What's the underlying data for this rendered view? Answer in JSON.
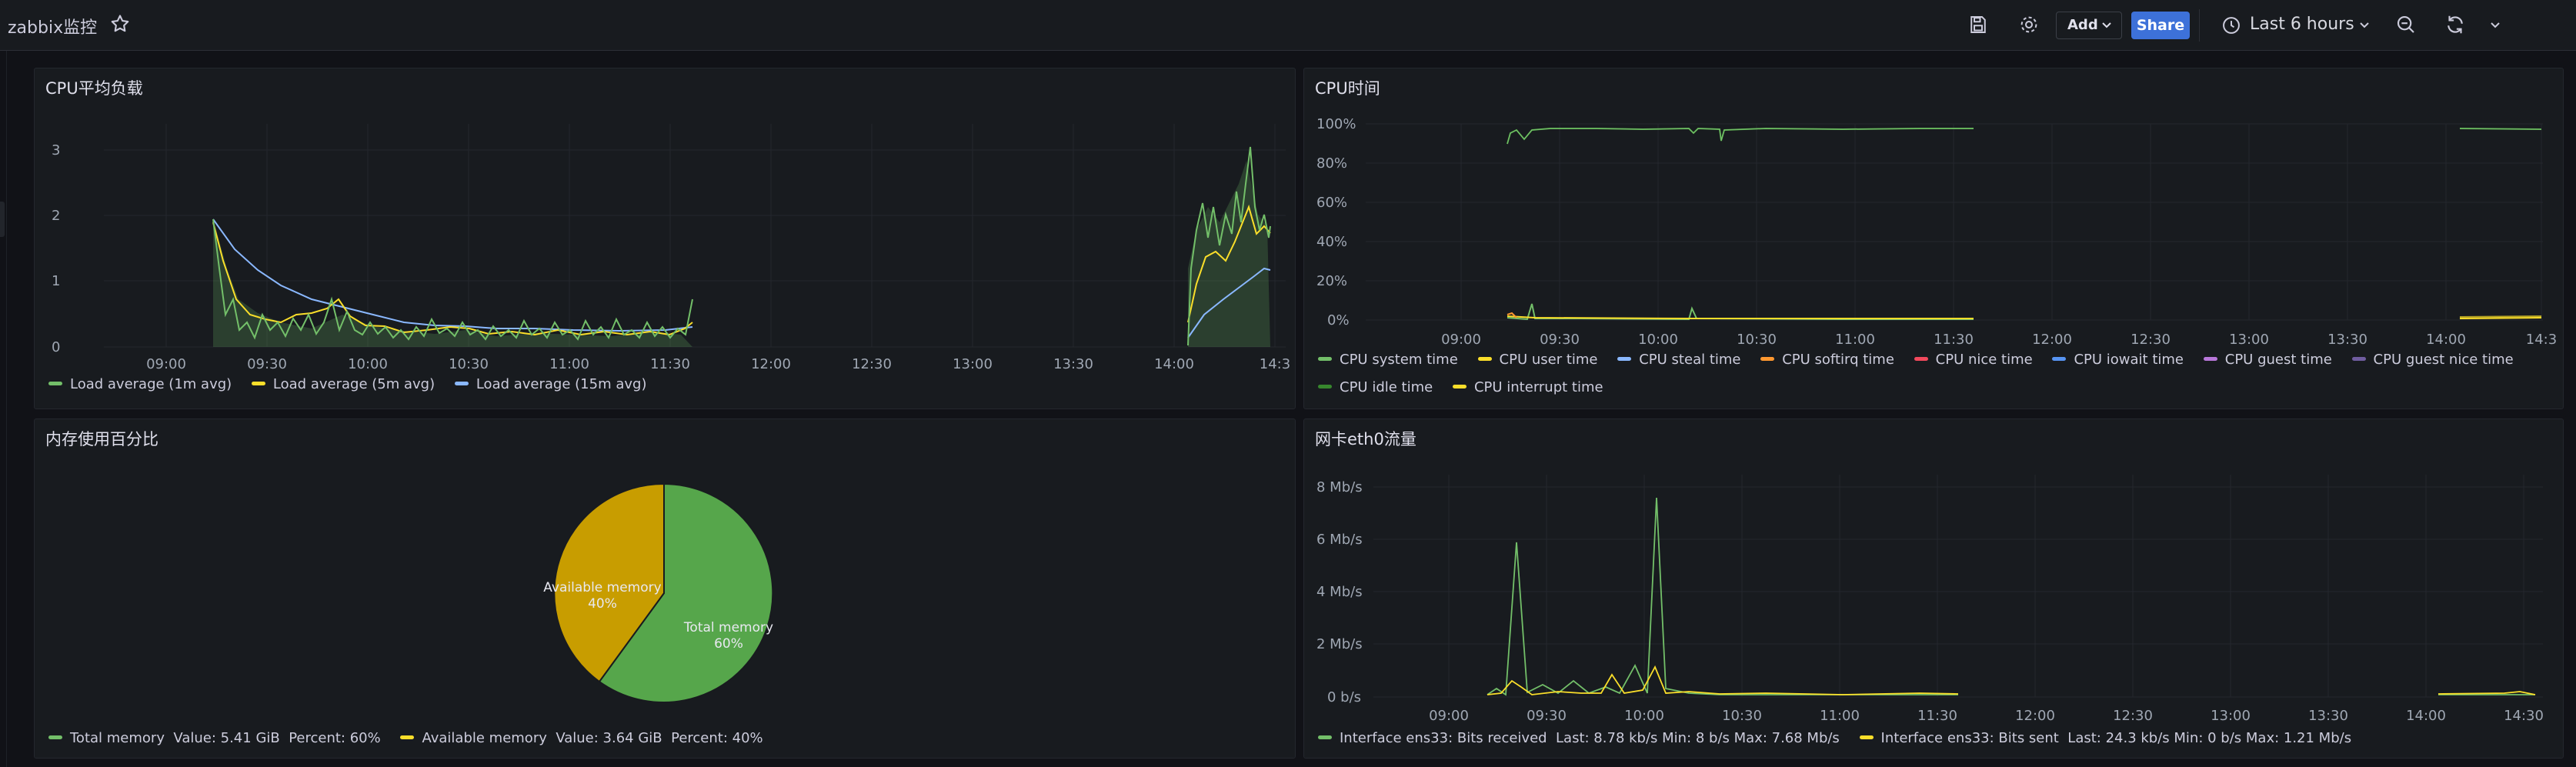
{
  "header": {
    "title": "zabbix监控",
    "add_label": "Add",
    "share_label": "Share",
    "time_range_label": "Last 6 hours"
  },
  "panels": {
    "cpu_load": {
      "title": "CPU平均负载",
      "x_ticks": [
        "09:00",
        "09:30",
        "10:00",
        "10:30",
        "11:00",
        "11:30",
        "12:00",
        "12:30",
        "13:00",
        "13:30",
        "14:00",
        "14:3"
      ],
      "y_ticks": [
        "3",
        "2",
        "1",
        "0"
      ],
      "legend": [
        {
          "label": "Load average (1m avg)",
          "color": "#73bf69"
        },
        {
          "label": "Load average (5m avg)",
          "color": "#fade2a"
        },
        {
          "label": "Load average (15m avg)",
          "color": "#8ab8ff"
        }
      ]
    },
    "cpu_time": {
      "title": "CPU时间",
      "x_ticks": [
        "09:00",
        "09:30",
        "10:00",
        "10:30",
        "11:00",
        "11:30",
        "12:00",
        "12:30",
        "13:00",
        "13:30",
        "14:00",
        "14:3"
      ],
      "y_ticks": [
        "100%",
        "80%",
        "60%",
        "40%",
        "20%",
        "0%"
      ],
      "legend_row1": [
        {
          "label": "CPU system time",
          "color": "#73bf69"
        },
        {
          "label": "CPU user time",
          "color": "#fade2a"
        },
        {
          "label": "CPU steal time",
          "color": "#8ab8ff"
        },
        {
          "label": "CPU softirq time",
          "color": "#ff9830"
        },
        {
          "label": "CPU nice time",
          "color": "#f2495c"
        },
        {
          "label": "CPU iowait time",
          "color": "#5794f2"
        },
        {
          "label": "CPU guest time",
          "color": "#b877d9"
        },
        {
          "label": "CPU guest nice time",
          "color": "#705da0"
        }
      ],
      "legend_row2": [
        {
          "label": "CPU idle time",
          "color": "#37872d"
        },
        {
          "label": "CPU interrupt time",
          "color": "#fade2a"
        }
      ]
    },
    "memory": {
      "title": "内存使用百分比",
      "slice_total_label": "Total memory",
      "slice_total_pct": "60%",
      "slice_avail_label": "Available memory",
      "slice_avail_pct": "40%",
      "legend": [
        {
          "label": "Total memory",
          "value_text": "Value: 5.41 GiB",
          "pct_text": "Percent: 60%",
          "color": "#73bf69"
        },
        {
          "label": "Available memory",
          "value_text": "Value: 3.64 GiB",
          "pct_text": "Percent: 40%",
          "color": "#fade2a"
        }
      ]
    },
    "network": {
      "title": "网卡eth0流量",
      "x_ticks": [
        "09:00",
        "09:30",
        "10:00",
        "10:30",
        "11:00",
        "11:30",
        "12:00",
        "12:30",
        "13:00",
        "13:30",
        "14:00",
        "14:30"
      ],
      "y_ticks": [
        "8 Mb/s",
        "6 Mb/s",
        "4 Mb/s",
        "2 Mb/s",
        "0 b/s"
      ],
      "legend": [
        {
          "label": "Interface ens33: Bits received",
          "stats": "Last: 8.78 kb/s   Min: 8 b/s   Max: 7.68 Mb/s",
          "color": "#73bf69"
        },
        {
          "label": "Interface ens33: Bits sent",
          "stats": "Last: 24.3 kb/s   Min: 0 b/s   Max: 1.21 Mb/s",
          "color": "#fade2a"
        }
      ]
    }
  },
  "chart_data": [
    {
      "type": "line",
      "title": "CPU平均负载",
      "ylim": [
        0,
        3.2
      ],
      "series": [
        {
          "name": "Load average (1m avg)",
          "x": [
            "09:16",
            "09:20",
            "09:30",
            "09:40",
            "09:50",
            "10:00",
            "10:10",
            "10:20",
            "10:30",
            "10:40",
            "10:50",
            "11:00",
            "11:10",
            "11:20",
            "11:30",
            "11:35",
            "14:05",
            "14:10",
            "14:15",
            "14:20",
            "14:25",
            "14:28",
            "14:30"
          ],
          "values": [
            1.9,
            1.3,
            0.5,
            0.3,
            0.4,
            0.7,
            0.3,
            0.4,
            0.5,
            0.3,
            0.2,
            0.3,
            0.4,
            0.3,
            0.3,
            0.7,
            0.5,
            2.1,
            2.3,
            1.8,
            2.0,
            3.05,
            1.8
          ]
        },
        {
          "name": "Load average (5m avg)",
          "x": [
            "09:16",
            "09:20",
            "09:30",
            "09:40",
            "09:50",
            "10:00",
            "10:10",
            "10:20",
            "10:30",
            "10:40",
            "10:50",
            "11:00",
            "11:10",
            "11:20",
            "11:30",
            "11:35",
            "14:05",
            "14:10",
            "14:15",
            "14:20",
            "14:25",
            "14:28",
            "14:30"
          ],
          "values": [
            1.8,
            1.1,
            0.6,
            0.4,
            0.35,
            0.6,
            0.35,
            0.35,
            0.4,
            0.3,
            0.25,
            0.3,
            0.3,
            0.3,
            0.3,
            0.4,
            0.4,
            1.4,
            1.5,
            1.3,
            1.6,
            2.2,
            1.9
          ]
        },
        {
          "name": "Load average (15m avg)",
          "x": [
            "09:16",
            "09:20",
            "09:30",
            "09:40",
            "09:50",
            "10:00",
            "10:10",
            "10:20",
            "10:30",
            "10:40",
            "10:50",
            "11:00",
            "11:10",
            "11:20",
            "11:30",
            "11:35",
            "14:05",
            "14:10",
            "14:15",
            "14:20",
            "14:25",
            "14:28",
            "14:30"
          ],
          "values": [
            1.8,
            1.4,
            1.0,
            0.7,
            0.5,
            0.5,
            0.4,
            0.35,
            0.35,
            0.3,
            0.3,
            0.3,
            0.3,
            0.3,
            0.3,
            0.35,
            0.1,
            0.6,
            0.8,
            0.9,
            1.1,
            1.4,
            1.45
          ]
        }
      ]
    },
    {
      "type": "line",
      "title": "CPU时间",
      "ylim": [
        0,
        100
      ],
      "series": [
        {
          "name": "CPU idle time",
          "x": [
            "09:15",
            "09:17",
            "09:22",
            "10:00",
            "10:12",
            "10:40",
            "11:37",
            "14:05",
            "14:30"
          ],
          "values": [
            93,
            98,
            92,
            98,
            92,
            98,
            98,
            98,
            97
          ]
        },
        {
          "name": "CPU user time",
          "x": [
            "09:15",
            "09:22",
            "10:00",
            "10:12",
            "11:37",
            "14:05",
            "14:30"
          ],
          "values": [
            2,
            1,
            1,
            1,
            1,
            1,
            1
          ]
        },
        {
          "name": "CPU system time",
          "x": [
            "09:15",
            "09:22",
            "09:24",
            "10:12",
            "10:14",
            "11:37",
            "14:05",
            "14:30"
          ],
          "values": [
            1,
            1,
            9,
            1,
            6,
            1,
            1,
            1
          ]
        }
      ]
    },
    {
      "type": "pie",
      "title": "内存使用百分比",
      "categories": [
        "Total memory",
        "Available memory"
      ],
      "values": [
        60,
        40
      ]
    },
    {
      "type": "line",
      "title": "网卡eth0流量",
      "ylim": [
        0,
        8.5
      ],
      "series": [
        {
          "name": "Interface ens33: Bits received",
          "x": [
            "09:12",
            "09:20",
            "09:24",
            "09:28",
            "09:40",
            "09:50",
            "10:00",
            "10:06",
            "10:10",
            "10:12",
            "10:14",
            "10:30",
            "11:00",
            "11:35",
            "14:00",
            "14:30"
          ],
          "values": [
            0.05,
            0.1,
            5.9,
            0.2,
            0.1,
            0.3,
            0.2,
            1.4,
            0.1,
            7.68,
            0.3,
            0.1,
            0.05,
            0.05,
            0.05,
            0.05
          ]
        },
        {
          "name": "Interface ens33: Bits sent",
          "x": [
            "09:12",
            "09:20",
            "09:27",
            "09:35",
            "09:58",
            "10:05",
            "10:12",
            "10:20",
            "11:35",
            "14:00",
            "14:30"
          ],
          "values": [
            0.05,
            0.1,
            0.6,
            0.1,
            0.8,
            0.1,
            1.21,
            0.1,
            0.05,
            0.05,
            0.05
          ]
        }
      ]
    }
  ]
}
